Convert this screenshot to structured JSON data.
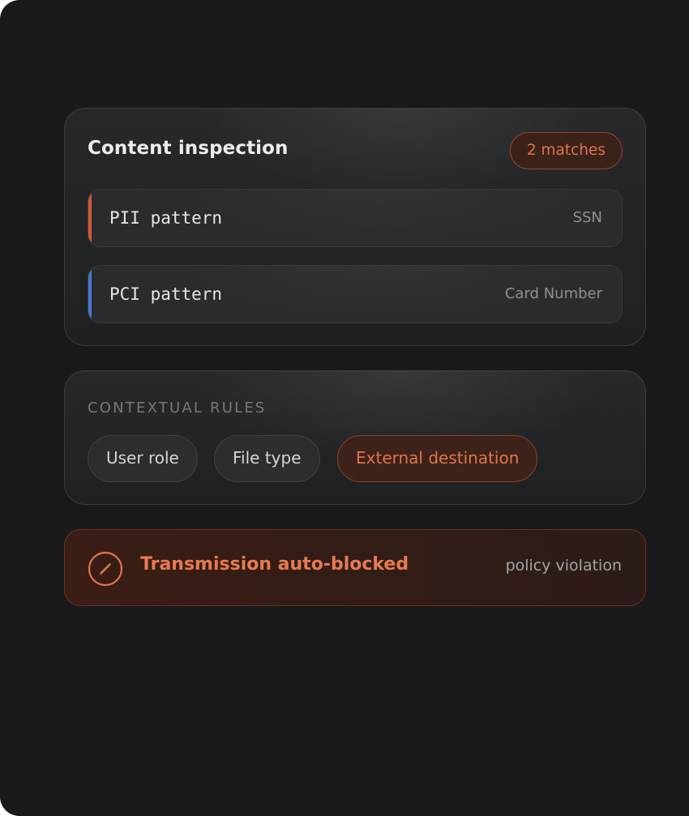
{
  "inspection": {
    "title": "Content inspection",
    "matches_badge": "2 matches",
    "patterns": [
      {
        "name": "PII pattern",
        "type": "SSN",
        "accent_color": "#d65a33"
      },
      {
        "name": "PCI pattern",
        "type": "Card Number",
        "accent_color": "#4a78d0"
      }
    ]
  },
  "contextual_rules": {
    "label": "CONTEXTUAL RULES",
    "chips": [
      {
        "label": "User role",
        "active": false
      },
      {
        "label": "File type",
        "active": false
      },
      {
        "label": "External destination",
        "active": true
      }
    ]
  },
  "alert": {
    "icon": "blocked-icon",
    "title": "Transmission auto-blocked",
    "reason": "policy violation"
  },
  "colors": {
    "background": "#19191b",
    "accent_orange": "#e2744e",
    "pii_accent": "#d65a33",
    "pci_accent": "#4a78d0"
  }
}
